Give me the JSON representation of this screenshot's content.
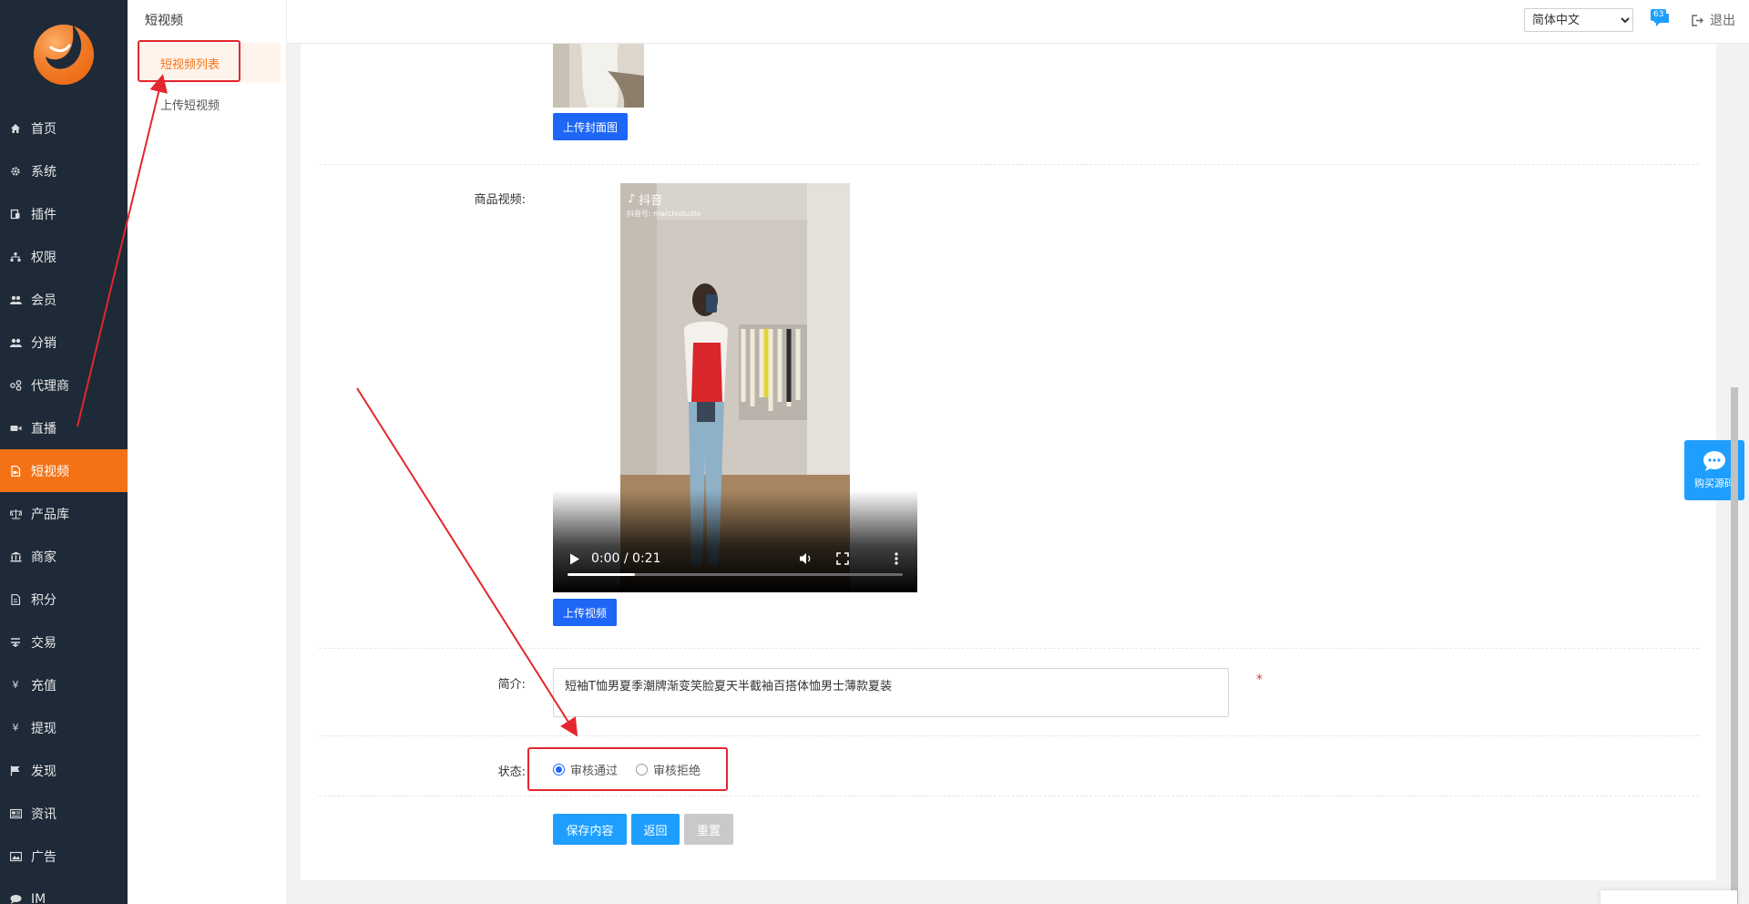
{
  "sidebar": {
    "items": [
      {
        "label": "首页",
        "icon": "home-icon"
      },
      {
        "label": "系统",
        "icon": "gear-icon"
      },
      {
        "label": "插件",
        "icon": "plugin-icon"
      },
      {
        "label": "权限",
        "icon": "sitemap-icon"
      },
      {
        "label": "会员",
        "icon": "users-icon"
      },
      {
        "label": "分销",
        "icon": "users-icon"
      },
      {
        "label": "代理商",
        "icon": "share-icon"
      },
      {
        "label": "直播",
        "icon": "video-camera-icon"
      },
      {
        "label": "短视频",
        "icon": "file-video-icon",
        "active": true
      },
      {
        "label": "产品库",
        "icon": "scale-icon"
      },
      {
        "label": "商家",
        "icon": "bank-icon"
      },
      {
        "label": "积分",
        "icon": "document-icon"
      },
      {
        "label": "交易",
        "icon": "trade-icon"
      },
      {
        "label": "充值",
        "icon": "yen-icon"
      },
      {
        "label": "提现",
        "icon": "yen-icon"
      },
      {
        "label": "发现",
        "icon": "flag-icon"
      },
      {
        "label": "资讯",
        "icon": "newspaper-icon"
      },
      {
        "label": "广告",
        "icon": "image-icon"
      },
      {
        "label": "IM",
        "icon": "chat-icon"
      }
    ]
  },
  "subnav": {
    "title": "短视频",
    "items": [
      {
        "label": "短视频列表",
        "active": true
      },
      {
        "label": "上传短视频"
      }
    ]
  },
  "header": {
    "language": "简体中文",
    "language_options": [
      "简体中文"
    ],
    "message_count": "63",
    "logout_label": "退出"
  },
  "form": {
    "upload_cover_label": "上传封面图",
    "video_label": "商品视频:",
    "video_watermark": "抖音",
    "video_account": "抖音号: marchistudio",
    "video_time": "0:00 / 0:21",
    "video_progress_fraction": 0.2,
    "upload_video_label": "上传视频",
    "intro_label": "简介:",
    "intro_value": "短袖T恤男夏季潮牌渐变笑脸夏天半截袖百搭体恤男士薄款夏装",
    "required_mark": "*",
    "status_label": "状态:",
    "status_options": [
      {
        "label": "审核通过",
        "checked": true
      },
      {
        "label": "审核拒绝",
        "checked": false
      }
    ],
    "save_label": "保存内容",
    "back_label": "返回",
    "reset_label": "重置"
  },
  "float_chat": {
    "label": "购买源码"
  },
  "colors": {
    "sidebar_bg": "#1e2a38",
    "accent": "#f47216",
    "primary_button": "#1e66f5",
    "chat_button": "#1e9fff",
    "annotation_red": "#e3262f"
  }
}
